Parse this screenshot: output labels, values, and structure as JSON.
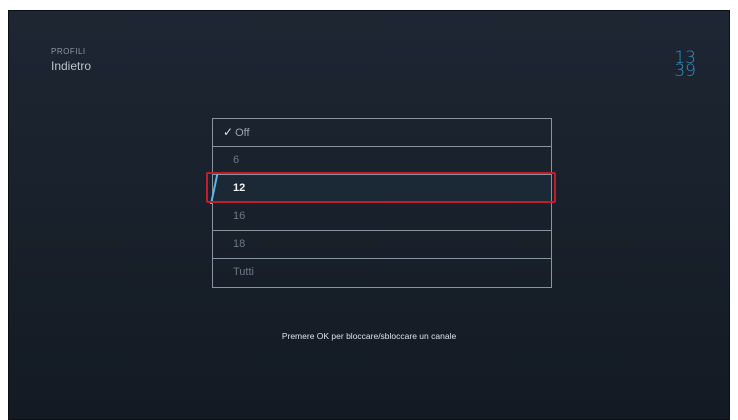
{
  "header": {
    "section_label": "PROFILI",
    "back_label": "Indietro"
  },
  "clock": {
    "hours": "13",
    "minutes": "39"
  },
  "options": {
    "items": [
      {
        "label": "Off",
        "selected": true
      },
      {
        "label": "6",
        "selected": false
      },
      {
        "label": "12",
        "selected": false,
        "focused": true
      },
      {
        "label": "16",
        "selected": false
      },
      {
        "label": "18",
        "selected": false
      },
      {
        "label": "Tutti",
        "selected": false
      }
    ]
  },
  "hint": {
    "text": "Premere OK per bloccare/sbloccare un canale"
  },
  "colors": {
    "accent": "#2f93c6",
    "highlight_border": "#c21e2a",
    "background": "#1a222d"
  }
}
